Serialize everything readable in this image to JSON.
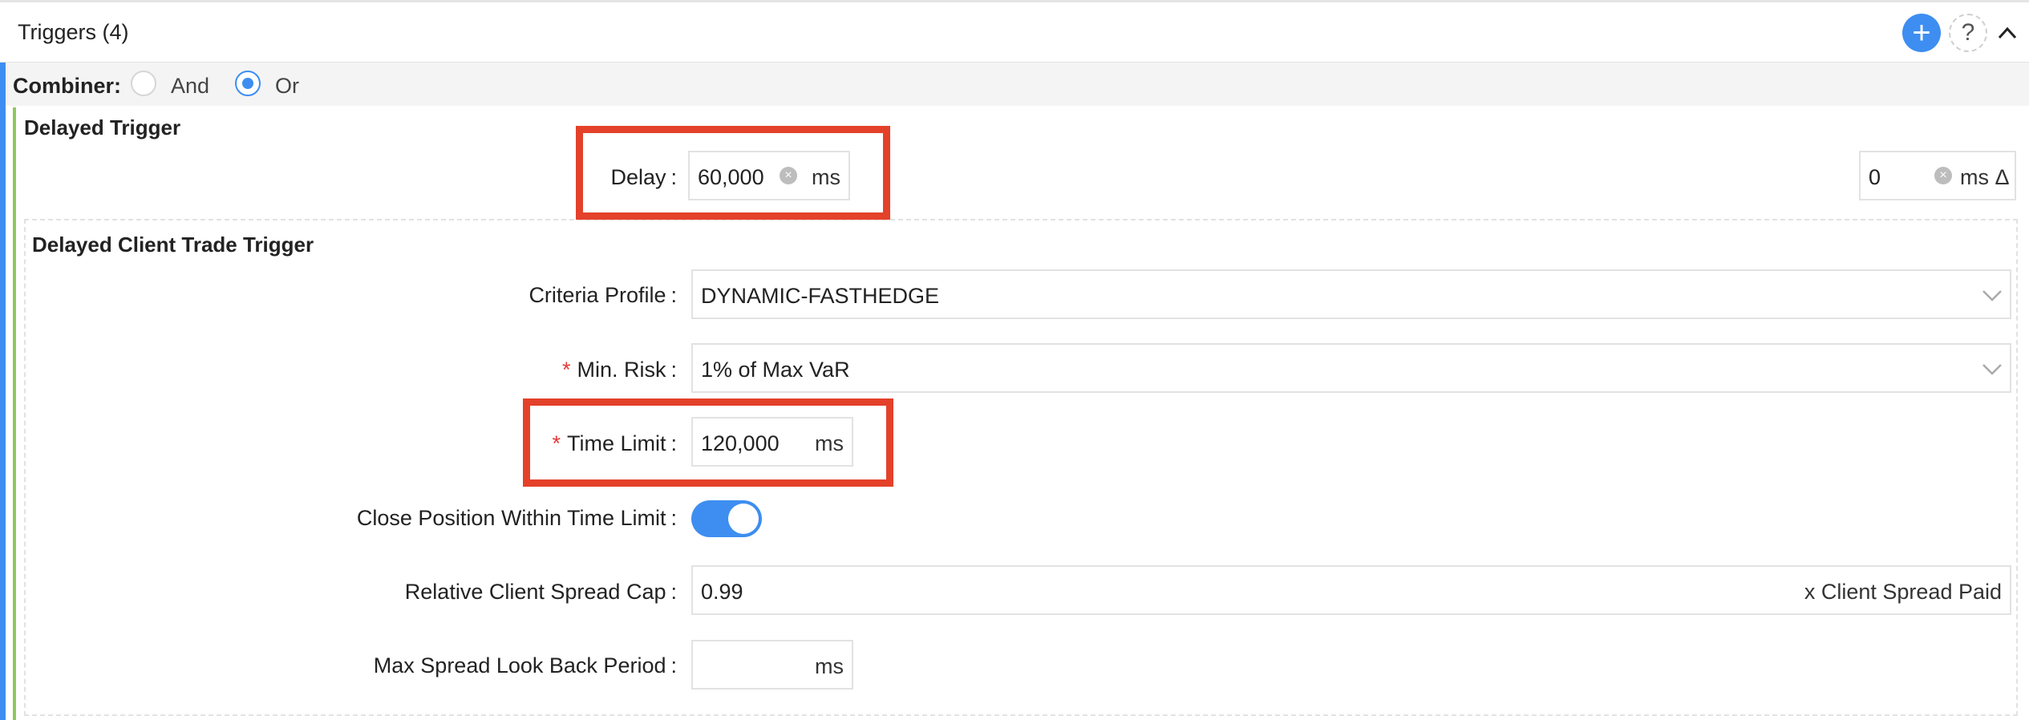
{
  "header": {
    "title": "Triggers (4)",
    "add_icon": "plus-icon",
    "help_icon": "question-icon",
    "collapse_icon": "chevron-up-icon"
  },
  "combiner": {
    "label": "Combiner:",
    "options": [
      {
        "label": "And",
        "selected": false
      },
      {
        "label": "Or",
        "selected": true
      }
    ]
  },
  "delayed_trigger": {
    "title": "Delayed Trigger",
    "delay_label": "Delay",
    "delay_value": "60,000",
    "delay_unit": "ms",
    "offset_value": "0",
    "offset_unit": "ms Δ"
  },
  "client_trade_trigger": {
    "title": "Delayed Client Trade Trigger",
    "criteria_profile_label": "Criteria Profile",
    "criteria_profile_value": "DYNAMIC-FASTHEDGE",
    "min_risk_label": "Min. Risk",
    "min_risk_value": "1% of Max VaR",
    "time_limit_label": "Time Limit",
    "time_limit_value": "120,000",
    "time_limit_unit": "ms",
    "close_position_label": "Close Position Within Time Limit",
    "close_position_on": true,
    "spread_cap_label": "Relative Client Spread Cap",
    "spread_cap_value": "0.99",
    "spread_cap_unit": "x Client Spread Paid",
    "lookback_label": "Max Spread Look Back Period",
    "lookback_value": "",
    "lookback_unit": "ms"
  },
  "colors": {
    "accent": "#3d8ef0",
    "highlight": "#e4412a",
    "required": "#e53935",
    "section_bar": "#8ec95a"
  }
}
